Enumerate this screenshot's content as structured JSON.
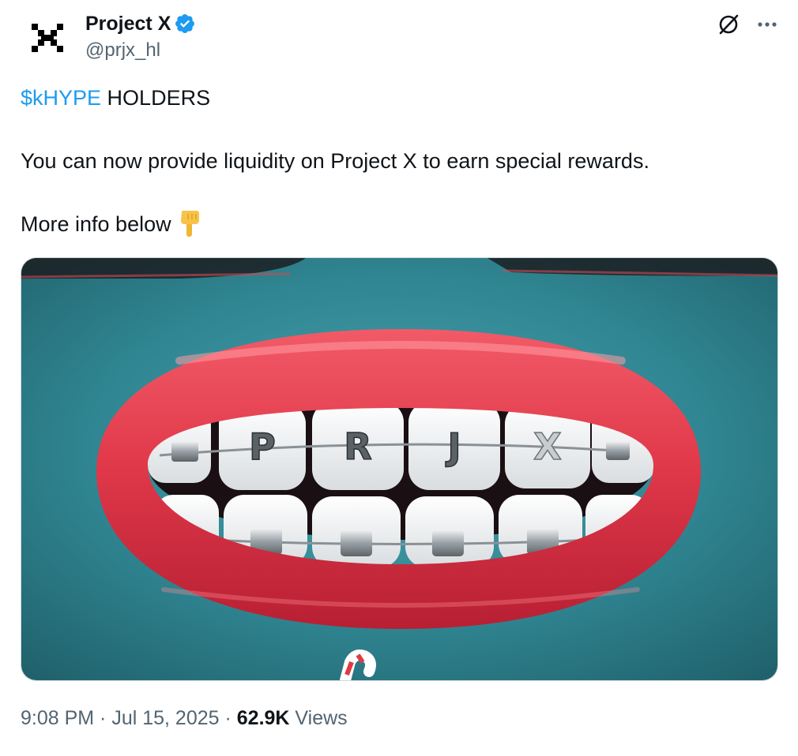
{
  "author": {
    "display_name": "Project X",
    "handle": "@prjx_hl",
    "verified": true,
    "avatar_icon": "project-x-logo"
  },
  "header_actions": {
    "grok_icon": "grok-icon",
    "more_icon": "more-dots-icon"
  },
  "tweet": {
    "cashtag": "$kHYPE",
    "line1_rest": " HOLDERS",
    "line2": "You can now provide liquidity on Project X to earn special rewards.",
    "line3": "More info below",
    "emoji": "backhand-index-pointing-down"
  },
  "media": {
    "braces_letters": [
      "P",
      "R",
      "J",
      "X"
    ]
  },
  "meta": {
    "time": "9:08 PM",
    "separator": " · ",
    "date": "Jul 15, 2025",
    "views_count": "62.9K",
    "views_label": " Views"
  },
  "colors": {
    "text": "#0f1419",
    "secondary": "#536471",
    "link": "#1d9bf0",
    "verified": "#1d9bf0"
  }
}
